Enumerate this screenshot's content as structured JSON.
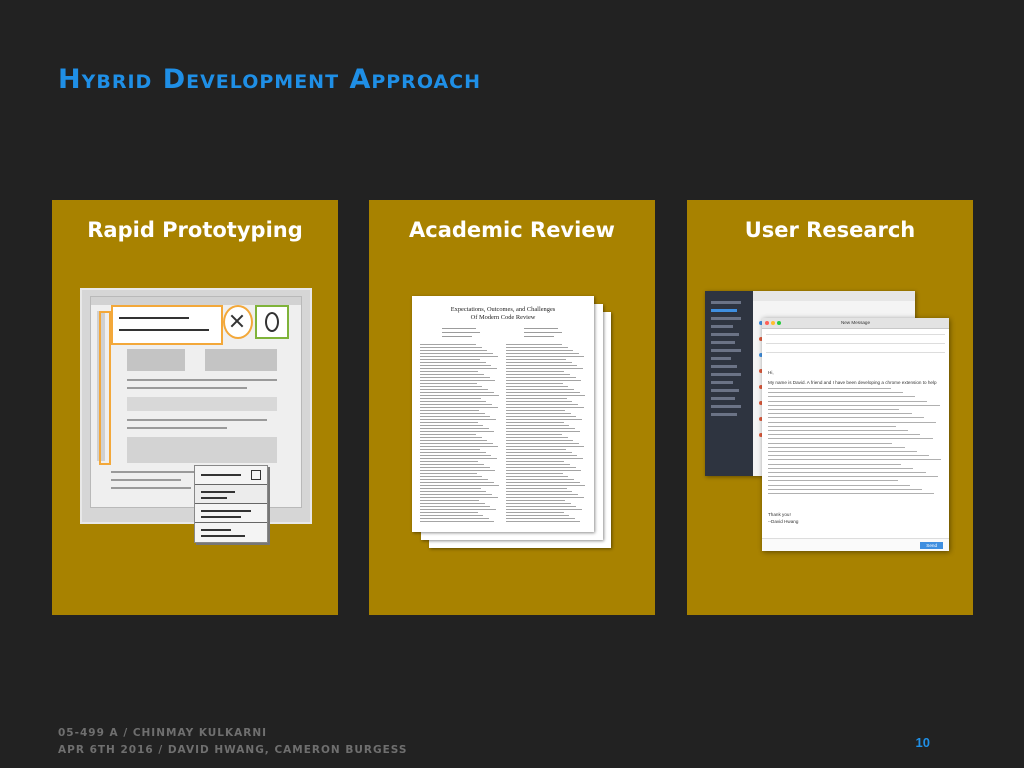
{
  "slide": {
    "title": "Hybrid Development Approach",
    "page_number": "10",
    "footer": {
      "line1": "05-499 A / CHINMAY KULKARNI",
      "line2": "APR 6TH 2016 / DAVID HWANG, CAMERON BURGESS"
    }
  },
  "cards": [
    {
      "title": "Rapid Prototyping"
    },
    {
      "title": "Academic Review"
    },
    {
      "title": "User Research"
    }
  ],
  "paper": {
    "title_line1": "Expectations, Outcomes, and Challenges",
    "title_line2": "Of Modern Code Review"
  },
  "email": {
    "window_title": "New Message",
    "greeting": "Hi,",
    "intro": "My name is David. A friend and I have been developing a chrome extension to help",
    "signoff": "Thank you!",
    "signature": "--David Hwang",
    "send_label": "Send"
  },
  "colors": {
    "background": "#222222",
    "accent": "#1f8fe6",
    "card": "#a88200"
  }
}
